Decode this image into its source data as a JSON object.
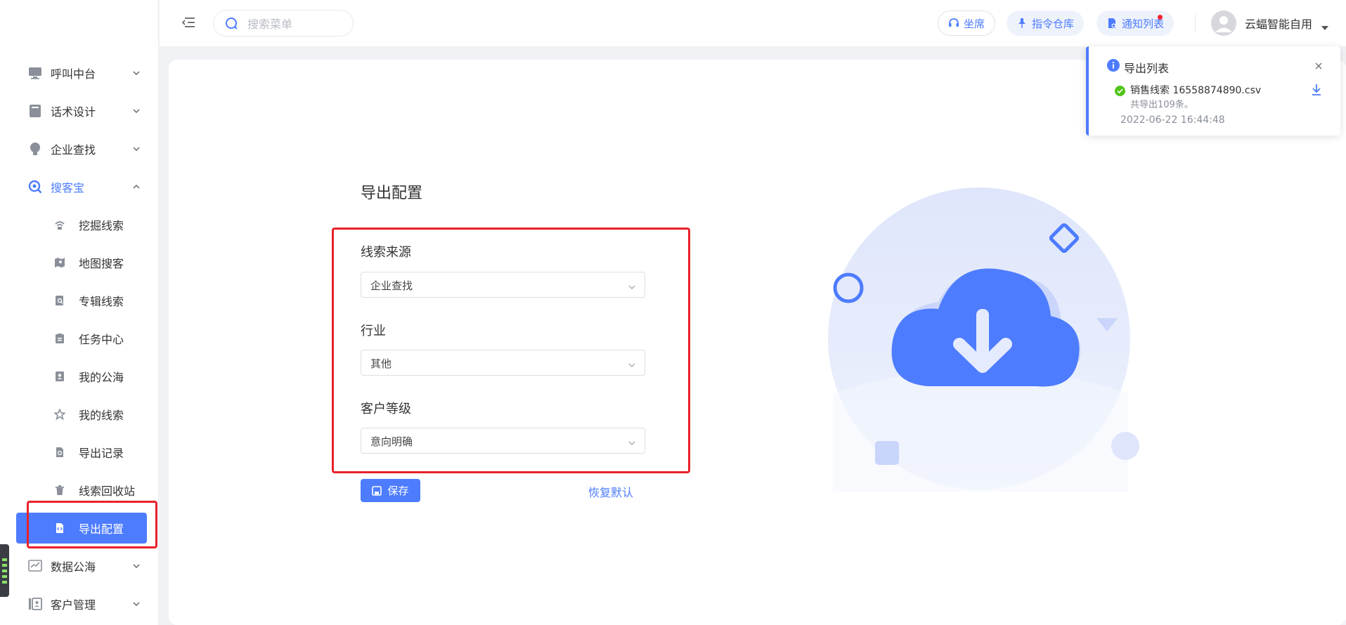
{
  "header": {
    "search_placeholder": "搜索菜单",
    "buttons": {
      "seat": "坐席",
      "command_repo": "指令仓库",
      "notice_list": "通知列表"
    },
    "user_name": "云蝠智能自用"
  },
  "sidebar": {
    "groups": [
      {
        "label": "呼叫中台"
      },
      {
        "label": "话术设计"
      },
      {
        "label": "企业查找"
      },
      {
        "label": "搜客宝"
      }
    ],
    "sub_items": [
      {
        "label": "挖掘线索"
      },
      {
        "label": "地图搜客"
      },
      {
        "label": "专辑线索"
      },
      {
        "label": "任务中心"
      },
      {
        "label": "我的公海"
      },
      {
        "label": "我的线索"
      },
      {
        "label": "导出记录"
      },
      {
        "label": "线索回收站"
      },
      {
        "label": "导出配置"
      }
    ],
    "groups_after": [
      {
        "label": "数据公海"
      },
      {
        "label": "客户管理"
      }
    ]
  },
  "main": {
    "title": "导出配置",
    "fields": [
      {
        "label": "线索来源",
        "value": "企业查找"
      },
      {
        "label": "行业",
        "value": "其他"
      },
      {
        "label": "客户等级",
        "value": "意向明确"
      }
    ],
    "save_label": "保存",
    "reset_label": "恢复默认"
  },
  "notification": {
    "title": "导出列表",
    "file_name": "销售线索 16558874890.csv",
    "count_text": "共导出109条。",
    "time": "2022-06-22 16:44:48"
  },
  "colors": {
    "accent": "#4d7cfe",
    "highlight_red": "#e8222a",
    "success": "#52c41a"
  }
}
